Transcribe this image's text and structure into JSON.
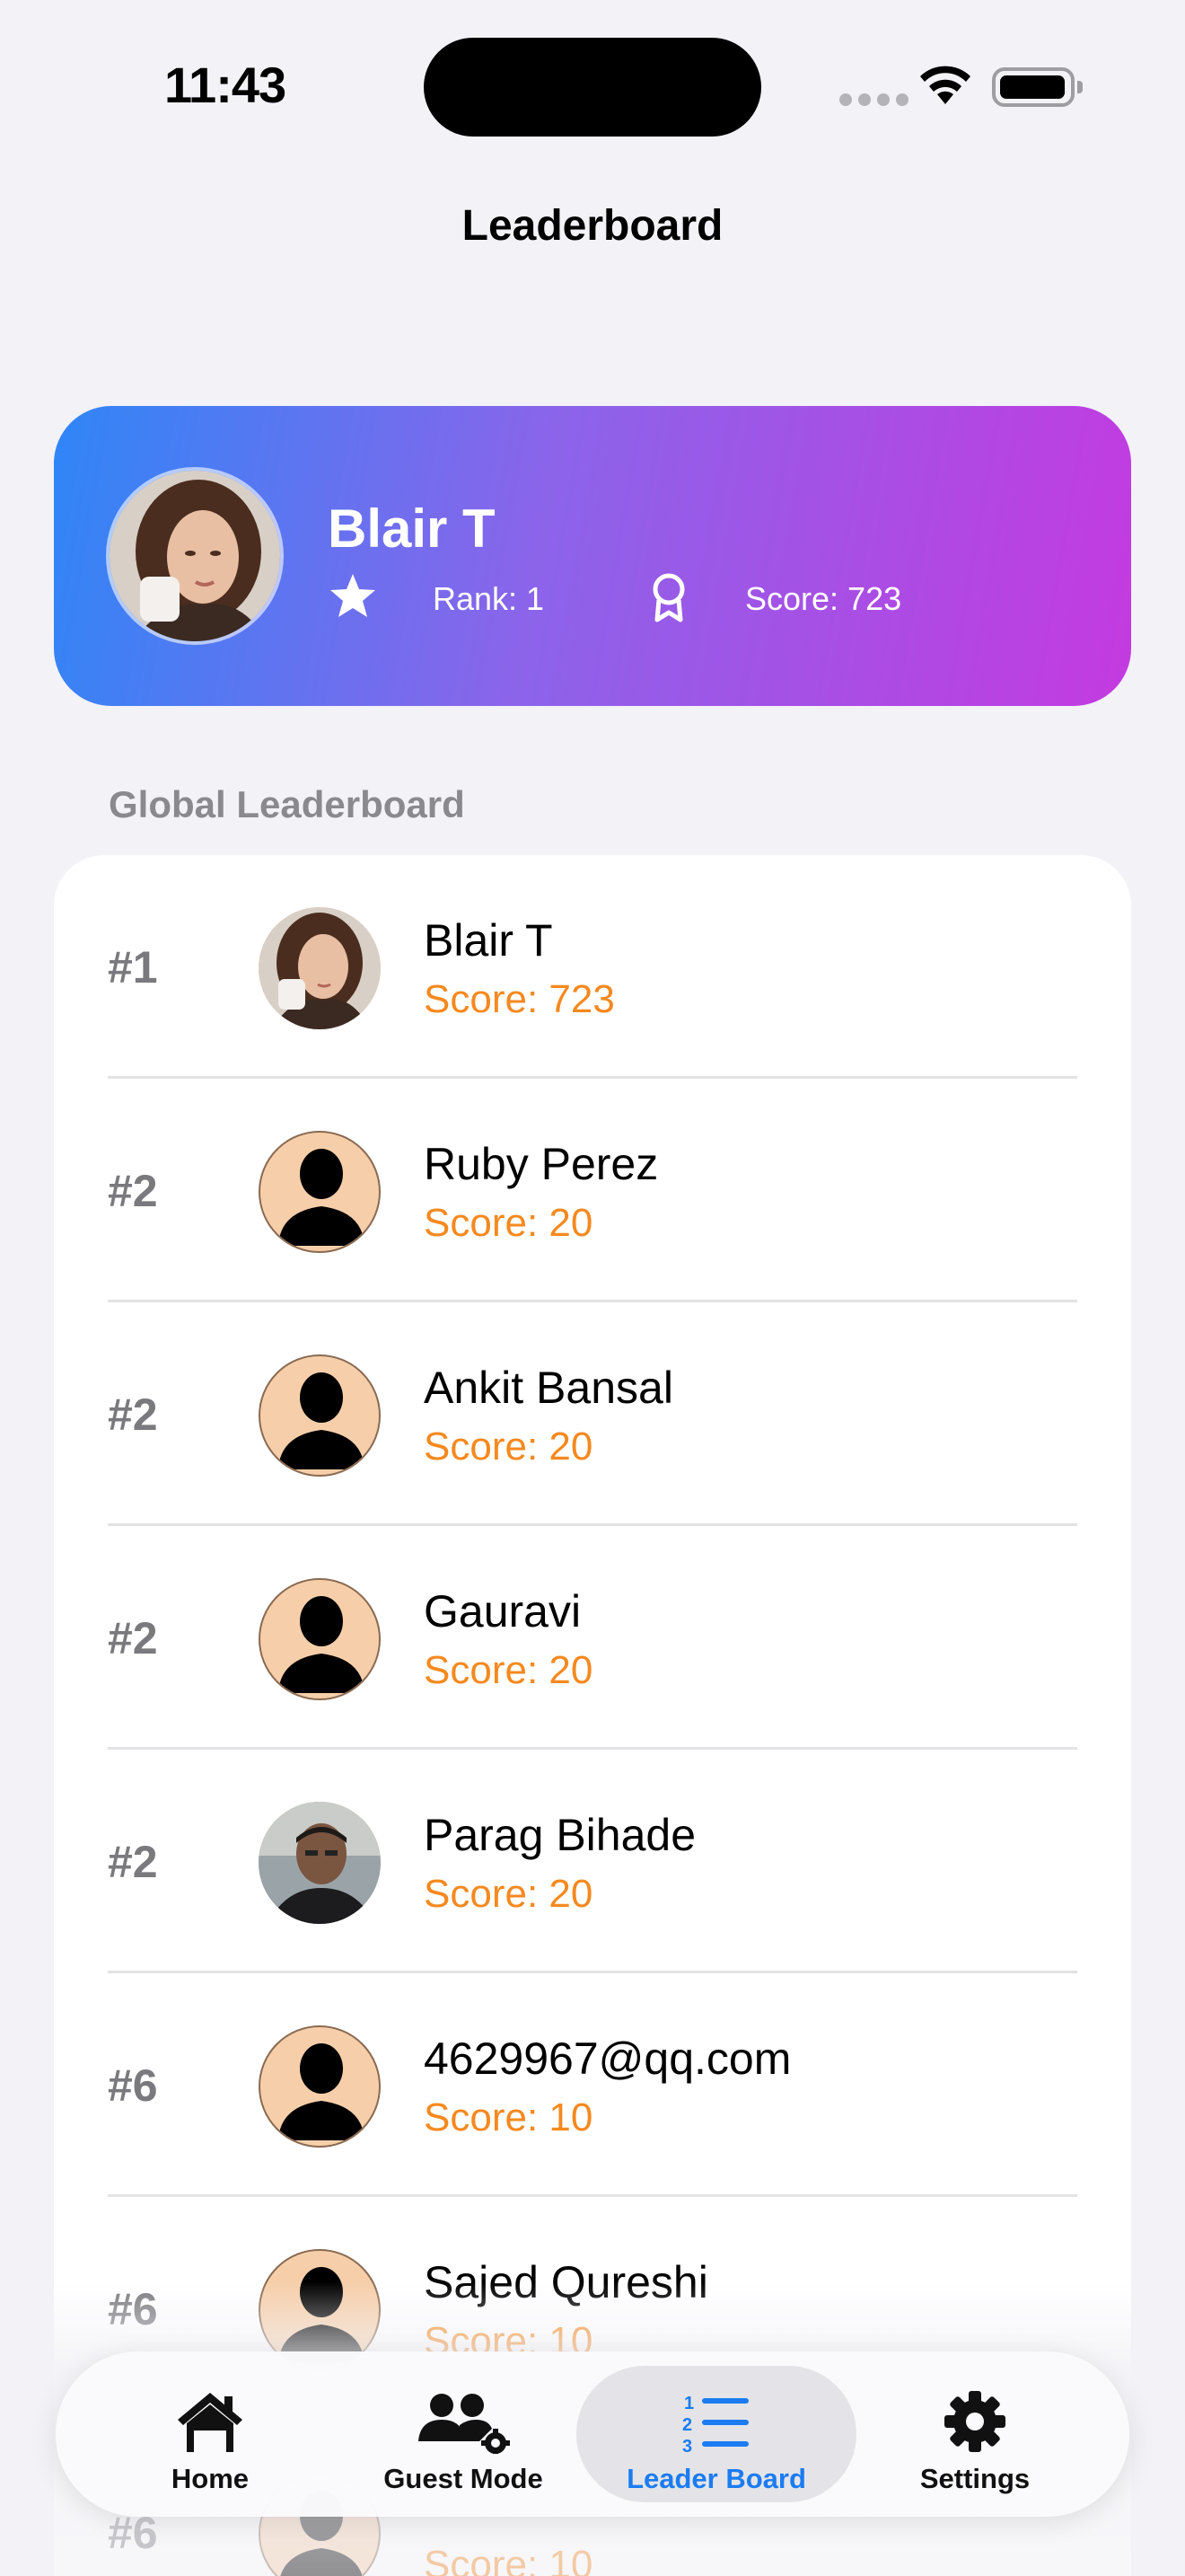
{
  "status_bar": {
    "time": "11:43"
  },
  "header": {
    "title": "Leaderboard"
  },
  "profile": {
    "name": "Blair T",
    "rank_text": "Rank: 1",
    "score_text": "Score: 723",
    "avatar_icon": "user-photo"
  },
  "section": {
    "label": "Global Leaderboard"
  },
  "leaderboard": [
    {
      "rank": "#1",
      "name": "Blair T",
      "score": "Score: 723",
      "avatar": "photo-woman"
    },
    {
      "rank": "#2",
      "name": "Ruby Perez",
      "score": "Score: 20",
      "avatar": "silhouette"
    },
    {
      "rank": "#2",
      "name": "Ankit Bansal",
      "score": "Score: 20",
      "avatar": "silhouette"
    },
    {
      "rank": "#2",
      "name": "Gauravi",
      "score": "Score: 20",
      "avatar": "silhouette"
    },
    {
      "rank": "#2",
      "name": "Parag Bihade",
      "score": "Score: 20",
      "avatar": "photo-man"
    },
    {
      "rank": "#6",
      "name": "4629967@qq.com",
      "score": "Score: 10",
      "avatar": "silhouette"
    },
    {
      "rank": "#6",
      "name": "Sajed Qureshi",
      "score": "Score: 10",
      "avatar": "silhouette"
    },
    {
      "rank": "#6",
      "name": "",
      "score": "Score: 10",
      "avatar": "silhouette"
    }
  ],
  "tab_bar": {
    "tabs": [
      {
        "label": "Home",
        "icon": "house-icon"
      },
      {
        "label": "Guest Mode",
        "icon": "guest-mode-icon"
      },
      {
        "label": "Leader Board",
        "icon": "numbered-list-icon",
        "active": true
      },
      {
        "label": "Settings",
        "icon": "gear-icon"
      }
    ]
  },
  "colors": {
    "accent": "#1b7cf2",
    "score": "#f5891f",
    "gradient_start": "#2f86f7",
    "gradient_end": "#c43ae0",
    "background": "#f2f2f7"
  }
}
